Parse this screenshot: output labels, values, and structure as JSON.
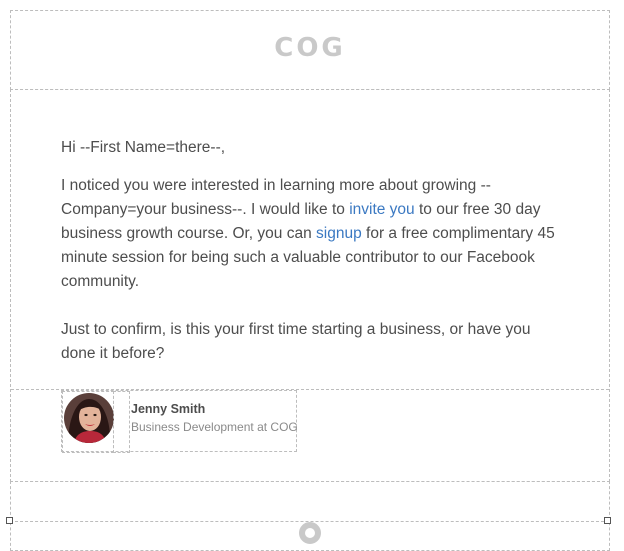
{
  "header": {
    "logo_text": "COG"
  },
  "email": {
    "greeting": "Hi --First Name=there--,",
    "paragraph1": {
      "part1": "I noticed you were interested in learning more about growing --Company=your business--. I would like to ",
      "link1": "invite you",
      "part2": " to our free 30 day business growth course. Or, you can ",
      "link2": "signup",
      "part3": " for a free complimentary 45 minute session for being such a valuable contributor to our Facebook community."
    },
    "paragraph2": "Just to confirm, is this your first time starting a business, or have you done it before?"
  },
  "signature": {
    "name": "Jenny Smith",
    "title": "Business Development at COG"
  },
  "colors": {
    "text": "#4d4d4d",
    "link": "#3b79c2",
    "logo": "#c9c9c9",
    "guide": "#bdbdbd"
  }
}
